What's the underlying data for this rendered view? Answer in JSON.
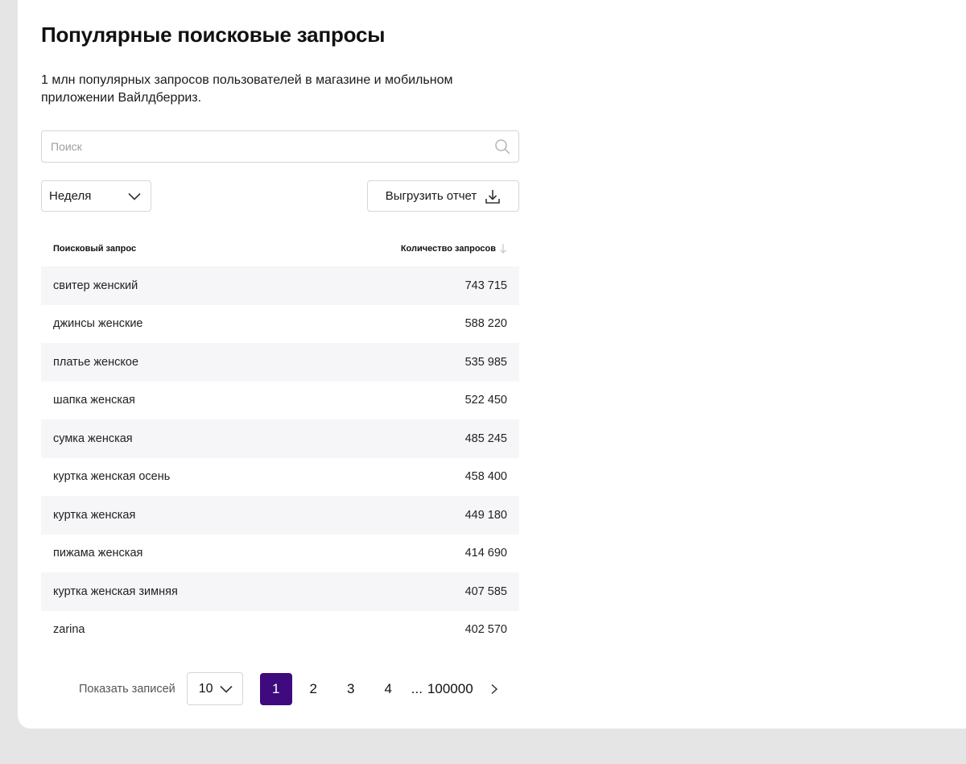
{
  "page": {
    "title": "Популярные поисковые запросы",
    "subtitle": "1 млн популярных запросов пользователей в магазине и мобильном приложении Вайлдберриз."
  },
  "search": {
    "placeholder": "Поиск",
    "value": ""
  },
  "filters": {
    "period_value": "Неделя",
    "export_label": "Выгрузить отчет"
  },
  "table": {
    "columns": [
      "Поисковый запрос",
      "Количество запросов"
    ],
    "rows": [
      {
        "query": "свитер женский",
        "count": "743 715"
      },
      {
        "query": "джинсы женские",
        "count": "588 220"
      },
      {
        "query": "платье женское",
        "count": "535 985"
      },
      {
        "query": "шапка женская",
        "count": "522 450"
      },
      {
        "query": "сумка женская",
        "count": "485 245"
      },
      {
        "query": "куртка женская осень",
        "count": "458 400"
      },
      {
        "query": "куртка женская",
        "count": "449 180"
      },
      {
        "query": "пижама женская",
        "count": "414 690"
      },
      {
        "query": "куртка женская зимняя",
        "count": "407 585"
      },
      {
        "query": "zarina",
        "count": "402 570"
      }
    ]
  },
  "pagination": {
    "show_label": "Показать записей",
    "page_size": "10",
    "pages": [
      "1",
      "2",
      "3",
      "4"
    ],
    "ellipsis": "...",
    "last_page": "100000",
    "active_page": "1"
  },
  "colors": {
    "accent": "#3f0a7e",
    "background": "#e5e5e5",
    "card": "#ffffff",
    "row_alt": "#f6f6f9",
    "border": "#d6d6d6"
  },
  "icons": {
    "search": "search-icon",
    "chevron": "chevron-down-icon",
    "download": "download-icon",
    "sort": "sort-arrow-down-icon",
    "next": "chevron-right-icon"
  }
}
